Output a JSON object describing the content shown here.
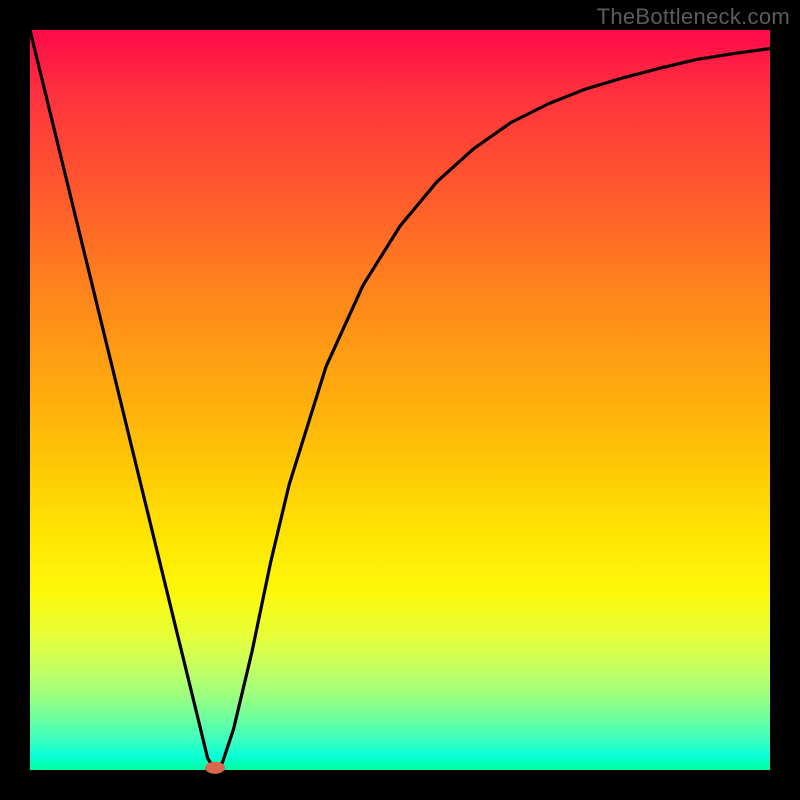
{
  "watermark": "TheBottleneck.com",
  "chart_data": {
    "type": "line",
    "title": "",
    "xlabel": "",
    "ylabel": "",
    "xlim": [
      0,
      1
    ],
    "ylim": [
      0,
      1
    ],
    "x": [
      0.0,
      0.05,
      0.1,
      0.15,
      0.2,
      0.225,
      0.24,
      0.25,
      0.26,
      0.275,
      0.3,
      0.325,
      0.35,
      0.4,
      0.45,
      0.5,
      0.55,
      0.6,
      0.65,
      0.7,
      0.75,
      0.8,
      0.85,
      0.9,
      0.95,
      1.0
    ],
    "values": [
      1.0,
      0.795,
      0.59,
      0.385,
      0.18,
      0.078,
      0.016,
      0.0,
      0.01,
      0.055,
      0.16,
      0.28,
      0.385,
      0.545,
      0.655,
      0.735,
      0.795,
      0.84,
      0.875,
      0.9,
      0.92,
      0.935,
      0.948,
      0.96,
      0.968,
      0.975
    ],
    "marker": {
      "x": 0.25,
      "y": 0.003,
      "color": "#d9684f"
    }
  },
  "colors": {
    "curve": "#000000",
    "marker": "#d9684f",
    "background_frame": "#000000"
  }
}
